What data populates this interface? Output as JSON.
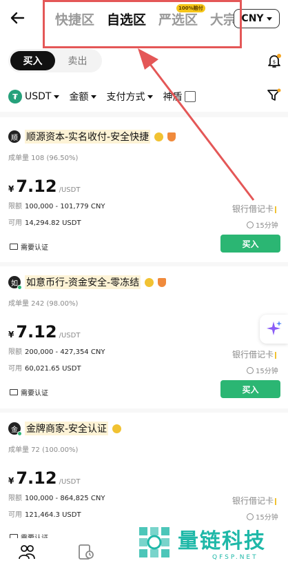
{
  "header": {
    "tabs": [
      {
        "label": "快捷区",
        "active": false
      },
      {
        "label": "自选区",
        "active": true
      },
      {
        "label": "严选区",
        "active": false,
        "badge": "100%赔付"
      },
      {
        "label": "大宗",
        "active": false
      }
    ],
    "currency": "CNY"
  },
  "trade_toggle": {
    "buy_label": "买入",
    "sell_label": "卖出",
    "selected": "buy"
  },
  "filters": {
    "asset": "USDT",
    "amount": "金额",
    "payment": "支付方式",
    "shield": "神盾"
  },
  "listings": [
    {
      "avatar": "顺",
      "name": "顺源资本-实名收付-安全快捷",
      "stats": "成单量 108 (96.50%)",
      "currency_symbol": "¥",
      "price": "7.12",
      "unit": "/USDT",
      "limit_label": "限额",
      "limit": "100,000 - 101,779 CNY",
      "available_label": "可用",
      "available": "14,294.82 USDT",
      "payment": "银行借记卡",
      "time": "15分钟",
      "buy_label": "买入",
      "verify": "需要认证"
    },
    {
      "avatar": "如",
      "name": "如意币行-资金安全-零冻结",
      "stats": "成单量 242 (98.00%)",
      "currency_symbol": "¥",
      "price": "7.12",
      "unit": "/USDT",
      "limit_label": "限额",
      "limit": "200,000 - 427,354 CNY",
      "available_label": "可用",
      "available": "60,021.65 USDT",
      "payment": "银行借记卡",
      "time": "15分钟",
      "buy_label": "买入",
      "verify": "需要认证"
    },
    {
      "avatar": "金",
      "name": "金牌商家-安全认证",
      "stats": "成单量 72 (100.00%)",
      "currency_symbol": "¥",
      "price": "7.12",
      "unit": "/USDT",
      "limit_label": "限额",
      "limit": "100,000 - 864,825 CNY",
      "available_label": "可用",
      "available": "121,464.3 USDT",
      "payment": "银行借记卡",
      "time": "15分钟",
      "verify": "需要认证"
    }
  ],
  "watermark": {
    "cn": "量链科技",
    "en": "QFSP.NET"
  },
  "colors": {
    "accent_green": "#2bb673",
    "highlight_red": "#e45757",
    "watermark_teal": "#1fb8a8"
  }
}
